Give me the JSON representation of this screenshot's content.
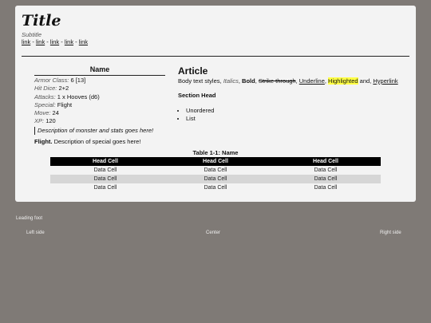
{
  "header": {
    "title": "Title",
    "subtitle": "Subtitle",
    "links": [
      "link",
      "link",
      "link",
      "link",
      "link"
    ]
  },
  "stat_block": {
    "name": "Name",
    "rows": [
      {
        "label": "Armor Class:",
        "value": "6 [13]"
      },
      {
        "label": "Hit Dice:",
        "value": "2+2"
      },
      {
        "label": "Attacks:",
        "value": "1 x Hooves (d6)"
      },
      {
        "label": "Special:",
        "value": "Flight"
      },
      {
        "label": "Move:",
        "value": "24"
      },
      {
        "label": "XP:",
        "value": "120"
      }
    ],
    "description": "Description of monster and stats goes here!",
    "special_title": "Flight.",
    "special_text": "Description of special goes here!"
  },
  "article": {
    "heading": "Article",
    "body_prefix": "Body text styles,",
    "italics": "Italics",
    "bold": "Bold",
    "strike": "Strike through",
    "underline": "Underline",
    "highlighted": "Highlighted",
    "and": "and,",
    "hyperlink": "Hyperlink",
    "section_head": "Section Head",
    "list": [
      "Unordered",
      "List"
    ]
  },
  "table": {
    "caption": "Table 1-1: Name",
    "headers": [
      "Head Cell",
      "Head Cell",
      "Head Cell"
    ],
    "rows": [
      [
        "Data Cell",
        "Data Cell",
        "Data Cell"
      ],
      [
        "Data Cell",
        "Data Cell",
        "Data Cell"
      ],
      [
        "Data Cell",
        "Data Cell",
        "Data Cell"
      ]
    ]
  },
  "footer": {
    "leading": "Leading foot",
    "left": "Left side",
    "center": "Center",
    "right": "Right side"
  }
}
